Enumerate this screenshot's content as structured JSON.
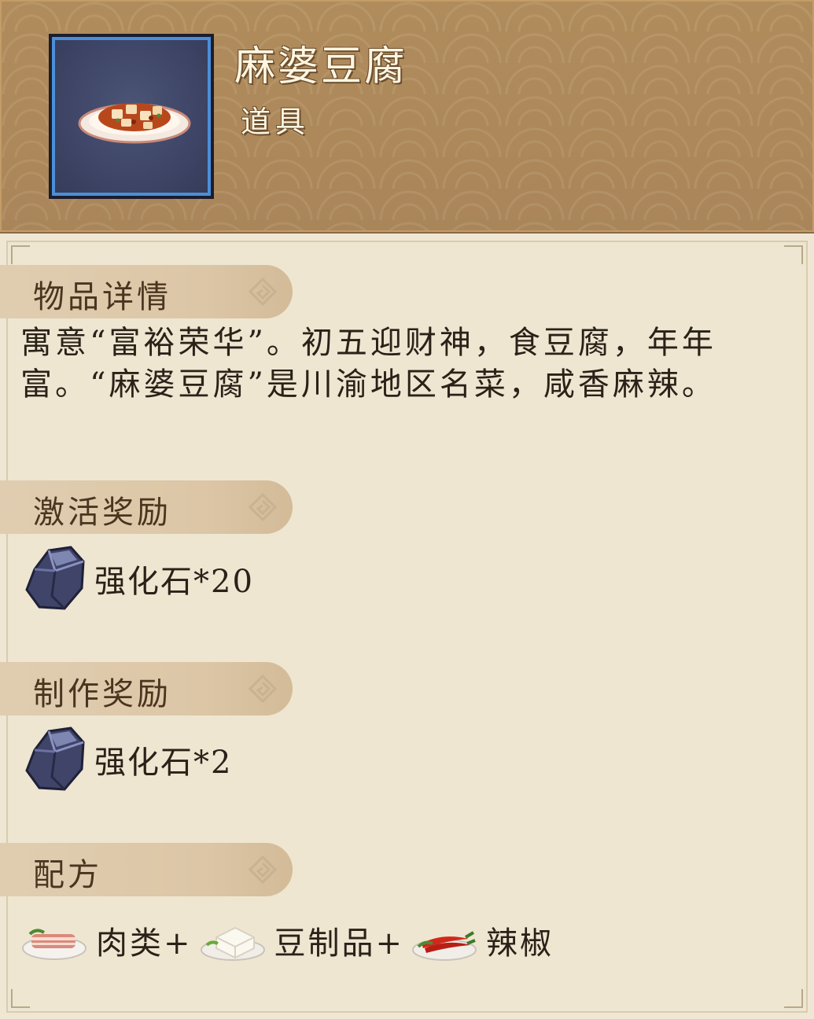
{
  "item": {
    "name": "麻婆豆腐",
    "type": "道具",
    "icon": "mapo-tofu-dish-icon"
  },
  "sections": {
    "details": {
      "title": "物品详情",
      "text": "寓意“富裕荣华”。初五迎财神，食豆腐，年年富。“麻婆豆腐”是川渝地区名菜，咸香麻辣。"
    },
    "activation_reward": {
      "title": "激活奖励",
      "item": "强化石*20",
      "icon": "enhancement-stone-icon"
    },
    "crafting_reward": {
      "title": "制作奖励",
      "item": "强化石*2",
      "icon": "enhancement-stone-icon"
    },
    "recipe": {
      "title": "配方",
      "ingredients": [
        {
          "label": "肉类+",
          "icon": "meat-plate-icon"
        },
        {
          "label": "豆制品+",
          "icon": "tofu-plate-icon"
        },
        {
          "label": "辣椒",
          "icon": "chili-plate-icon"
        }
      ]
    }
  },
  "colors": {
    "header_bg": "#a9855a",
    "panel_bg": "#eee6d1",
    "tab_bg": "#dcc6a6",
    "frame_border": "#4b8fd8"
  }
}
